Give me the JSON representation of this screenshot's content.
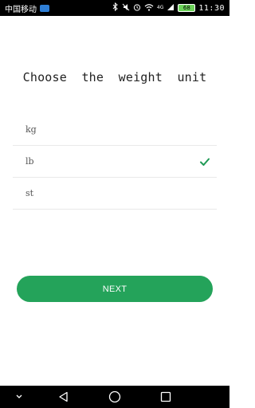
{
  "status_bar": {
    "carrier": "中国移动",
    "battery": "68",
    "network": "4G",
    "time": "11:30",
    "icons": [
      "bluetooth-icon",
      "mute-icon",
      "alarm-icon",
      "wifi-icon",
      "signal-icon",
      "battery-icon"
    ]
  },
  "screen": {
    "title": "Choose  the  weight  unit"
  },
  "units": [
    {
      "label": "kg",
      "selected": false
    },
    {
      "label": "lb",
      "selected": true
    },
    {
      "label": "st",
      "selected": false
    }
  ],
  "next_button": {
    "label": "NEXT"
  },
  "colors": {
    "accent": "#24a35a",
    "check": "#1f9a55",
    "divider": "#e9e9e9",
    "status_bar": "#000000"
  },
  "nav_bar": {
    "icons": [
      "chevron-down-icon",
      "back-icon",
      "home-icon",
      "recents-icon"
    ]
  }
}
